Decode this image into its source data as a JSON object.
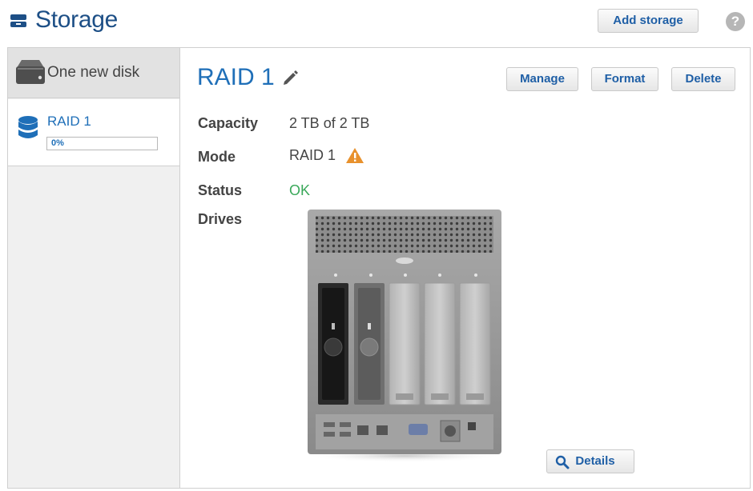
{
  "header": {
    "title": "Storage",
    "add_storage_label": "Add storage",
    "help_symbol": "?",
    "icons": {
      "storage": "storage-drawer-icon",
      "help": "help-icon"
    }
  },
  "sidebar": {
    "items": [
      {
        "label": "One new disk",
        "icon": "disk-drive-icon",
        "selected": false
      },
      {
        "label": "RAID 1",
        "icon": "database-icon",
        "progress_label": "0%",
        "progress_value": 0,
        "selected": true
      }
    ]
  },
  "detail": {
    "title": "RAID 1",
    "edit_icon": "pencil-icon",
    "actions": {
      "manage": "Manage",
      "format": "Format",
      "delete": "Delete"
    },
    "fields": [
      {
        "label": "Capacity",
        "value": "2 TB of 2 TB"
      },
      {
        "label": "Mode",
        "value": "RAID 1",
        "icon": "warning-icon"
      },
      {
        "label": "Status",
        "value": "OK"
      },
      {
        "label": "Drives",
        "value": ""
      }
    ],
    "details_label": "Details",
    "details_icon": "magnifier-icon"
  },
  "colors": {
    "accent": "#1f6fb8",
    "title_blue": "#1d4f86",
    "ok_green": "#3aa85a",
    "warning_orange": "#e8912c",
    "progress_fill": "#3a8be0"
  }
}
